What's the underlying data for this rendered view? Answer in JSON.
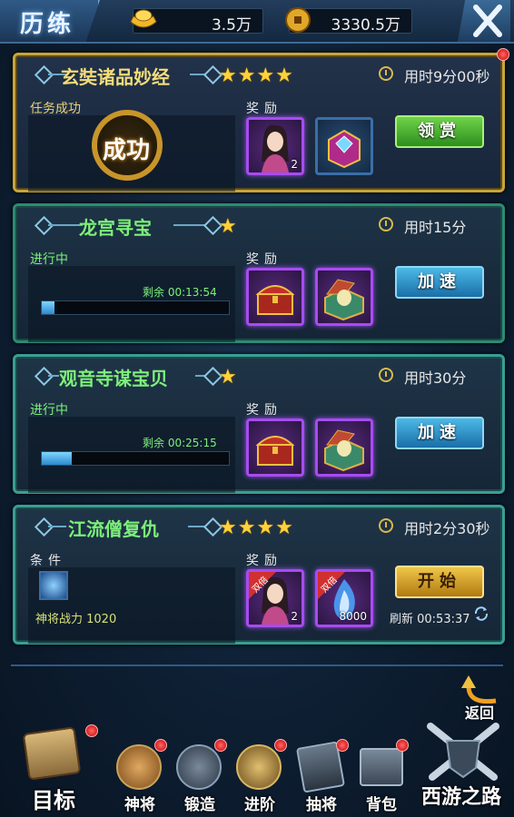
{
  "header": {
    "title": "历练",
    "ingot_amount": "3.5万",
    "coin_amount": "3330.5万"
  },
  "missions": [
    {
      "name": "玄奘诸品妙经",
      "stars": "★★★★",
      "time": "用时9分00秒",
      "status": "任务成功",
      "stamp": "成功",
      "reward_label": "奖励",
      "reward_qty": "2",
      "button": "领赏"
    },
    {
      "name": "龙宫寻宝",
      "stars": "★",
      "time": "用时15分",
      "status": "进行中",
      "reward_label": "奖励",
      "remain": "剩余 00:13:54",
      "progress": 0.07,
      "button": "加速"
    },
    {
      "name": "观音寺谋宝贝",
      "stars": "★",
      "time": "用时30分",
      "status": "进行中",
      "reward_label": "奖励",
      "remain": "剩余 00:25:15",
      "progress": 0.16,
      "button": "加速"
    },
    {
      "name": "江流僧复仇",
      "stars": "★★★★",
      "time": "用时2分30秒",
      "status": "条件",
      "power": "神将战力 1020",
      "reward_label": "奖励",
      "badge": "双倍",
      "reward_qty": "2",
      "reward_qty2": "8000",
      "button": "开始",
      "refresh": "刷新  00:53:37"
    }
  ],
  "back_label": "返回",
  "nav": [
    {
      "label": "目标"
    },
    {
      "label": "神将"
    },
    {
      "label": "锻造"
    },
    {
      "label": "进阶"
    },
    {
      "label": "抽将"
    },
    {
      "label": "背包"
    },
    {
      "label": "西游之路"
    }
  ]
}
